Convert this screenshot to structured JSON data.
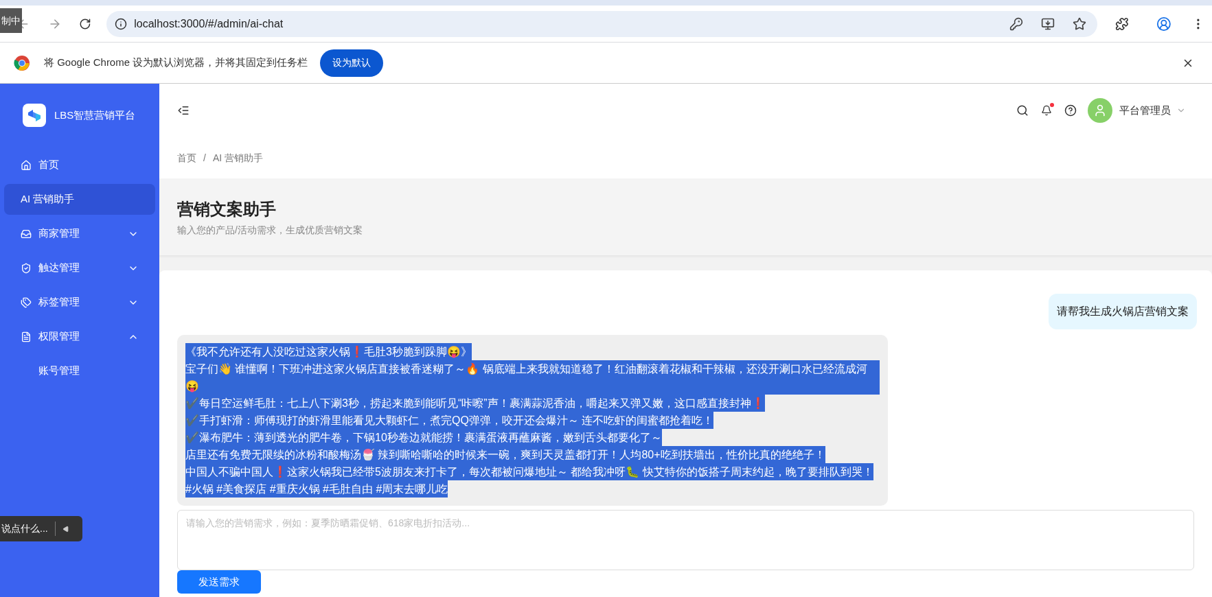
{
  "browser": {
    "url": "localhost:3000/#/admin/ai-chat",
    "overlay_top": "制中"
  },
  "infobar": {
    "message": "将 Google Chrome 设为默认浏览器，并将其固定到任务栏",
    "button": "设为默认"
  },
  "sidebar": {
    "brand": "LBS智慧营销平台",
    "items": [
      {
        "label": "首页",
        "kind": "home",
        "selected": false
      },
      {
        "label": "AI 营销助手",
        "selected": true
      },
      {
        "label": "商家管理",
        "kind": "shop",
        "expanded": false
      },
      {
        "label": "触达管理",
        "kind": "shield",
        "expanded": false
      },
      {
        "label": "标签管理",
        "kind": "tag",
        "expanded": false
      },
      {
        "label": "权限管理",
        "kind": "doc",
        "expanded": true,
        "children": [
          {
            "label": "账号管理",
            "selected": false
          }
        ]
      }
    ]
  },
  "header": {
    "user": "平台管理员",
    "notification_dot": true
  },
  "breadcrumb": {
    "separator": "/",
    "items": [
      "首页",
      "AI 营销助手"
    ]
  },
  "page": {
    "title": "营销文案助手",
    "subtitle": "输入您的产品/活动需求，生成优质营销文案"
  },
  "chat": {
    "messages": [
      {
        "kind": "user",
        "text": "请帮我生成火锅店营销文案"
      },
      {
        "kind": "assistant",
        "text_selected": true,
        "lines": [
          "《我不允许还有人没吃过这家火锅❗毛肚3秒脆到跺脚😝》",
          "宝子们👋 谁懂啊！下班冲进这家火锅店直接被香迷糊了～🔥 锅底端上来我就知道稳了！红油翻滚着花椒和干辣椒，还没开涮口水已经流成河😝",
          "✔️每日空运鲜毛肚：七上八下涮3秒，捞起来脆到能听见“咔嚓”声！裹满蒜泥香油，嚼起来又弹又嫩，这口感直接封神❗",
          "✔️手打虾滑：师傅现打的虾滑里能看见大颗虾仁，煮完QQ弹弹，咬开还会爆汁～ 连不吃虾的闺蜜都抢着吃！",
          "✔️瀑布肥牛：薄到透光的肥牛卷，下锅10秒卷边就能捞！裹满蛋液再蘸麻酱，嫩到舌头都要化了～",
          "店里还有免费无限续的冰粉和酸梅汤🍧 辣到嘶哈嘶哈的时候来一碗，爽到天灵盖都打开！人均80+吃到扶墙出，性价比真的绝绝子！",
          "中国人不骗中国人❗这家火锅我已经带5波朋友来打卡了，每次都被问爆地址～ 都给我冲呀🐛 快艾特你的饭搭子周末约起，晚了要排队到哭！",
          "#火锅 #美食探店 #重庆火锅 #毛肚自由 #周末去哪儿吃"
        ]
      }
    ],
    "input": {
      "placeholder": "请输入您的营销需求，例如：夏季防晒霜促销、618家电折扣活动..."
    },
    "send_button": "发送需求"
  },
  "overlay_bottom": {
    "text": "说点什么..."
  }
}
